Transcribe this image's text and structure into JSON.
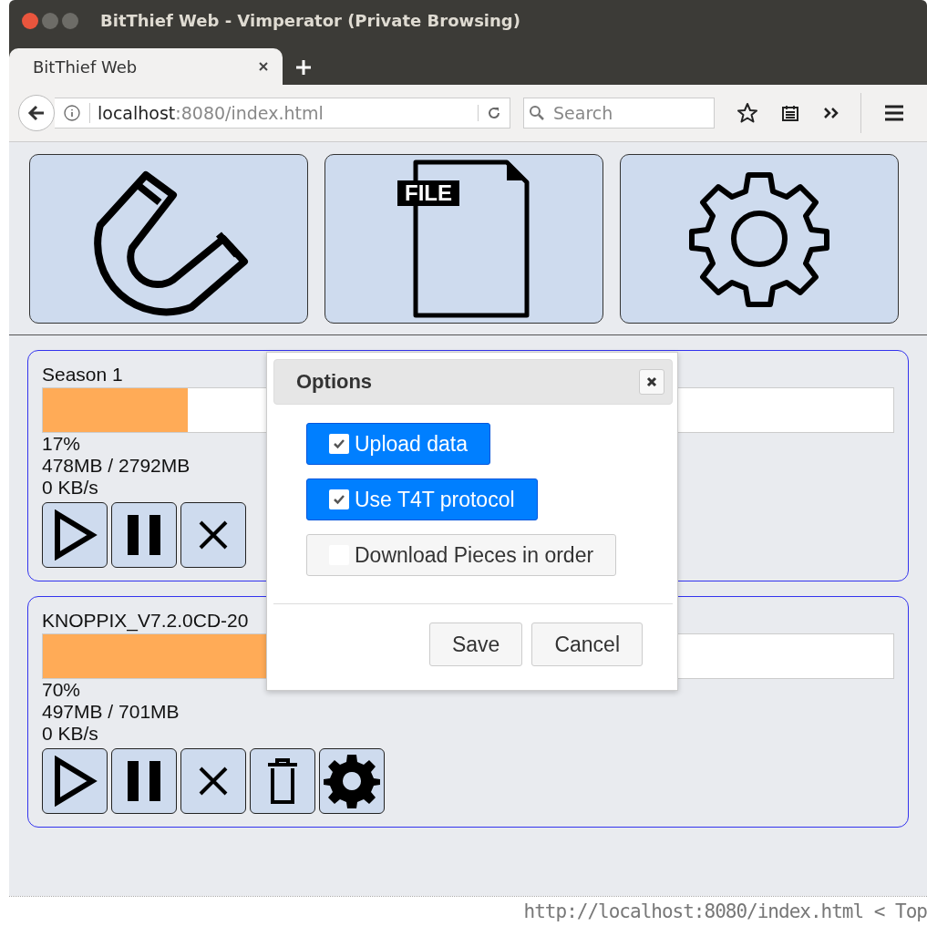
{
  "window": {
    "title": "BitThief Web - Vimperator (Private Browsing)"
  },
  "tabs": [
    {
      "label": "BitThief Web",
      "selected": true
    }
  ],
  "address_bar": {
    "host": "localhost",
    "path": ":8080/index.html"
  },
  "search": {
    "placeholder": "Search"
  },
  "toolbar": [
    {
      "kind": "magnet"
    },
    {
      "kind": "file",
      "label": "FILE"
    },
    {
      "kind": "settings"
    }
  ],
  "torrents": [
    {
      "name": "Season 1",
      "level": 0.17,
      "percent": "17%",
      "size": "478MB / 2792MB",
      "speed": "0 KB/s",
      "buttons": [
        {
          "kind": "play"
        },
        {
          "kind": "pause"
        },
        {
          "kind": "stop"
        }
      ]
    },
    {
      "name": "KNOPPIX_V7.2.0CD-20",
      "level": 0.7,
      "percent": "70%",
      "size": "497MB / 701MB",
      "speed": "0 KB/s",
      "buttons": [
        {
          "kind": "play"
        },
        {
          "kind": "pause"
        },
        {
          "kind": "stop"
        },
        {
          "kind": "delete"
        },
        {
          "kind": "settings"
        }
      ]
    }
  ],
  "dialog": {
    "title": "Options",
    "options": [
      {
        "label": "Upload data",
        "checked": true
      },
      {
        "label": "Use T4T protocol",
        "checked": true
      },
      {
        "label": "Download Pieces in order",
        "checked": false
      }
    ],
    "buttons": [
      "Save",
      "Cancel"
    ]
  },
  "status_bar": "http://localhost:8080/index.html < Top"
}
